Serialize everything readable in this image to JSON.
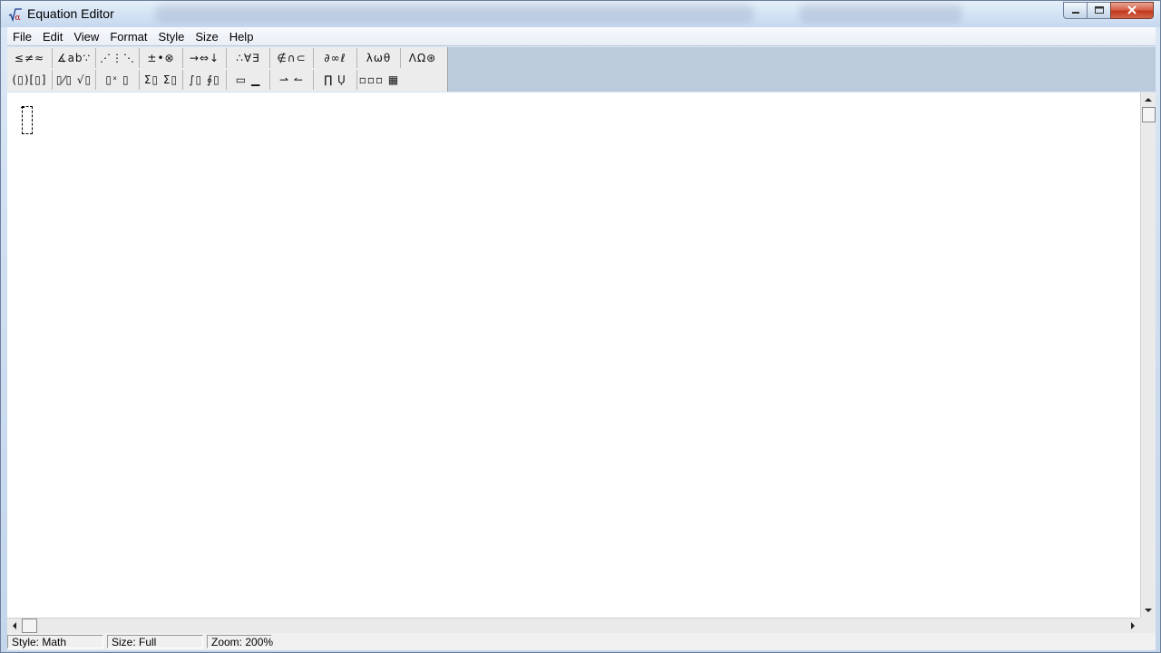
{
  "window": {
    "title": "Equation Editor",
    "icon": "sqrt-alpha-icon",
    "controls": [
      "minimize",
      "restore",
      "close"
    ]
  },
  "menu": {
    "items": [
      {
        "label": "File"
      },
      {
        "label": "Edit"
      },
      {
        "label": "View"
      },
      {
        "label": "Format"
      },
      {
        "label": "Style"
      },
      {
        "label": "Size"
      },
      {
        "label": "Help"
      }
    ]
  },
  "palette": {
    "row1": [
      {
        "symbols": "≤≠≈",
        "name": "relational-symbols"
      },
      {
        "symbols": "∡ab∵",
        "name": "spaces-and-ellipses"
      },
      {
        "symbols": "⋰⋮⋱",
        "name": "embellishments"
      },
      {
        "symbols": "±•⊗",
        "name": "operator-symbols"
      },
      {
        "symbols": "→⇔↓",
        "name": "arrow-symbols"
      },
      {
        "symbols": "∴∀∃",
        "name": "logical-symbols"
      },
      {
        "symbols": "∉∩⊂",
        "name": "set-theory-symbols"
      },
      {
        "symbols": "∂∞ℓ",
        "name": "miscellaneous-symbols"
      },
      {
        "symbols": "λωθ",
        "name": "greek-lowercase"
      },
      {
        "symbols": "ΛΩ⊛",
        "name": "greek-uppercase"
      }
    ],
    "row2": [
      {
        "symbols": "(▯)[▯]",
        "name": "fence-templates"
      },
      {
        "symbols": "▯⁄▯ √▯",
        "name": "fraction-radical-templates"
      },
      {
        "symbols": "▯ˣ ▯",
        "name": "subscript-superscript-templates"
      },
      {
        "symbols": "Σ▯ Σ▯",
        "name": "summation-templates"
      },
      {
        "symbols": "∫▯ ∮▯",
        "name": "integral-templates"
      },
      {
        "symbols": "▭ ▁",
        "name": "underbar-overbar-templates"
      },
      {
        "symbols": "⇀ ↼",
        "name": "labeled-arrow-templates"
      },
      {
        "symbols": "∏ Ụ",
        "name": "products-set-theory-templates"
      },
      {
        "symbols": "▫▫▫ ▦",
        "name": "matrix-templates"
      }
    ]
  },
  "status": {
    "style": "Style: Math",
    "size": "Size: Full",
    "zoom": "Zoom: 200%"
  }
}
